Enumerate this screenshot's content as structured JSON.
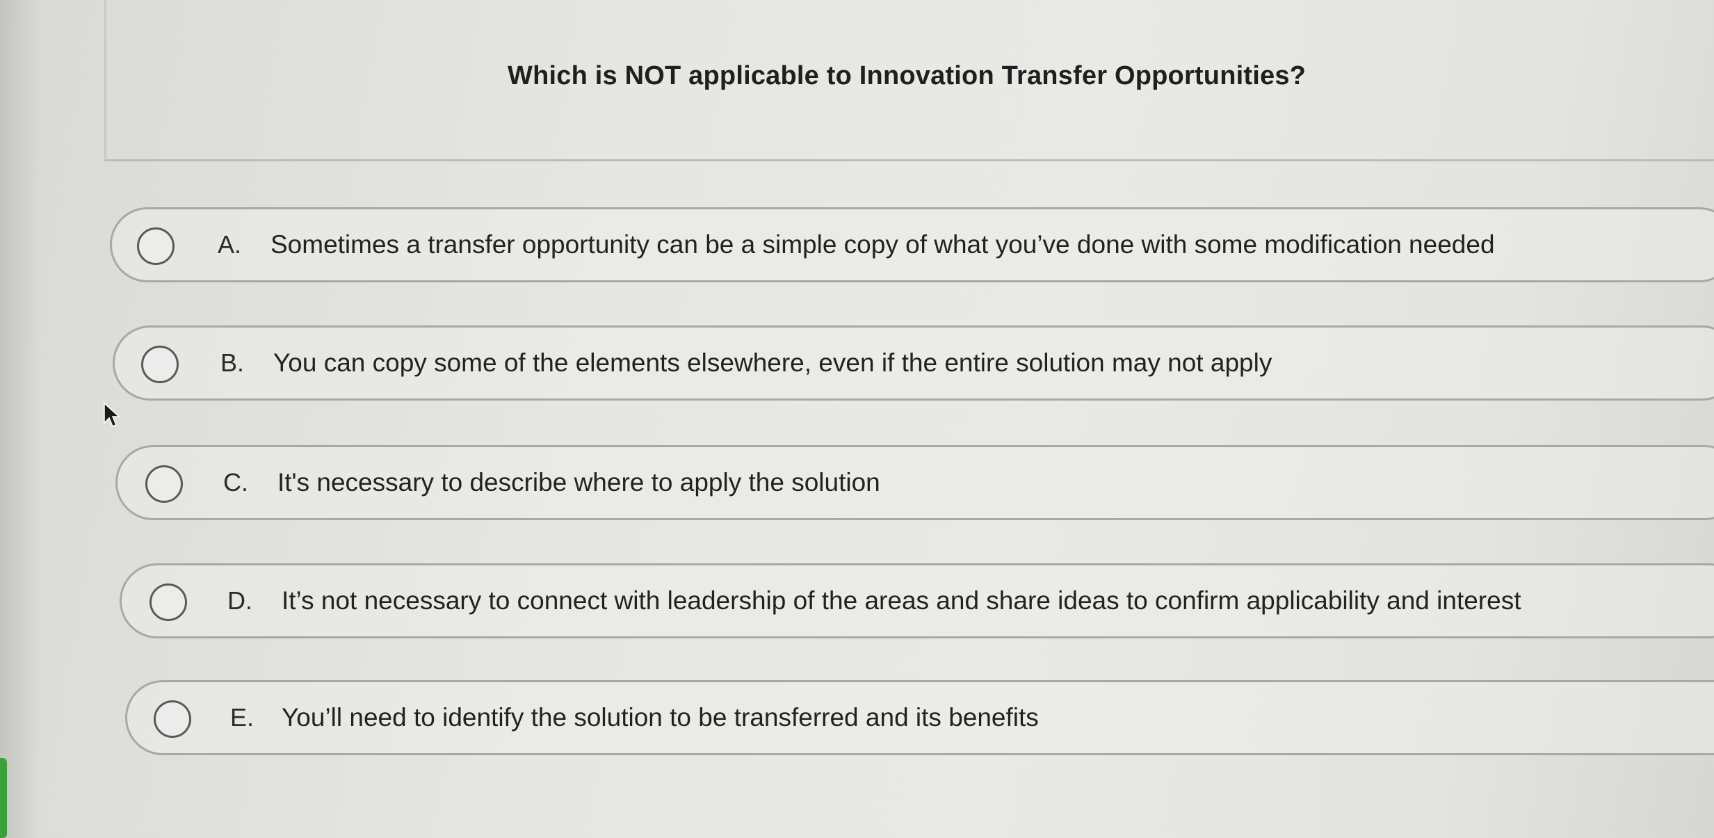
{
  "question": {
    "text": "Which is NOT applicable to Innovation Transfer Opportunities?"
  },
  "options": [
    {
      "letter": "A.",
      "text": "Sometimes a transfer opportunity can be a simple copy of what you’ve done with some modification needed"
    },
    {
      "letter": "B.",
      "text": "You can copy some of the elements elsewhere, even if the entire solution may not apply"
    },
    {
      "letter": "C.",
      "text": "It's necessary to describe where to apply the solution"
    },
    {
      "letter": "D.",
      "text": "It’s not necessary to connect with leadership of the areas and share ideas to confirm applicability and interest"
    },
    {
      "letter": "E.",
      "text": "You’ll need to identify the solution to be transferred and its benefits"
    }
  ],
  "selected_option": null,
  "icons": {
    "radio": "radio-unselected-icon",
    "cursor": "mouse-pointer-icon"
  },
  "colors": {
    "accent_strip": "#3aa13a",
    "border": "#a8a8a5",
    "text": "#222222"
  }
}
